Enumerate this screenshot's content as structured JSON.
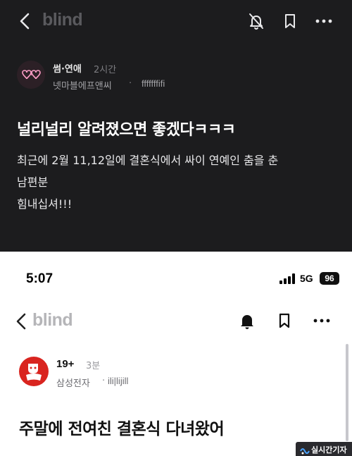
{
  "top_post": {
    "app_logo": "blind",
    "header_icons": [
      "back-chevron-icon",
      "bell-muted-icon",
      "bookmark-icon",
      "more-icon"
    ],
    "author": {
      "category": "썸·연애",
      "time": "2시간",
      "company": "넷마블에프앤씨",
      "separator": "·",
      "username": "fffffffifi"
    },
    "title": "널리널리 알려졌으면 좋겠다ㅋㅋㅋ",
    "body_lines": [
      "최근에 2월 11,12일에 결혼식에서 싸이 연예인 춤을 춘",
      "남편분",
      "힘내십셔!!!"
    ]
  },
  "bottom_post": {
    "status_bar": {
      "time": "5:07",
      "network": "5G",
      "battery": "96"
    },
    "app_logo": "blind",
    "header_icons": [
      "back-chevron-icon",
      "bell-icon",
      "bookmark-icon",
      "more-icon"
    ],
    "author": {
      "category": "19+",
      "time": "3분",
      "company": "삼성전자",
      "separator": "·",
      "username": "ili|lijill"
    },
    "title": "주말에 전여친 결혼식 다녀왔어"
  },
  "watermark": {
    "text": "실시간기자"
  },
  "colors": {
    "dark_bg": "#1c1c1e",
    "light_bg": "#ffffff",
    "avatar_red": "#d9241f"
  }
}
